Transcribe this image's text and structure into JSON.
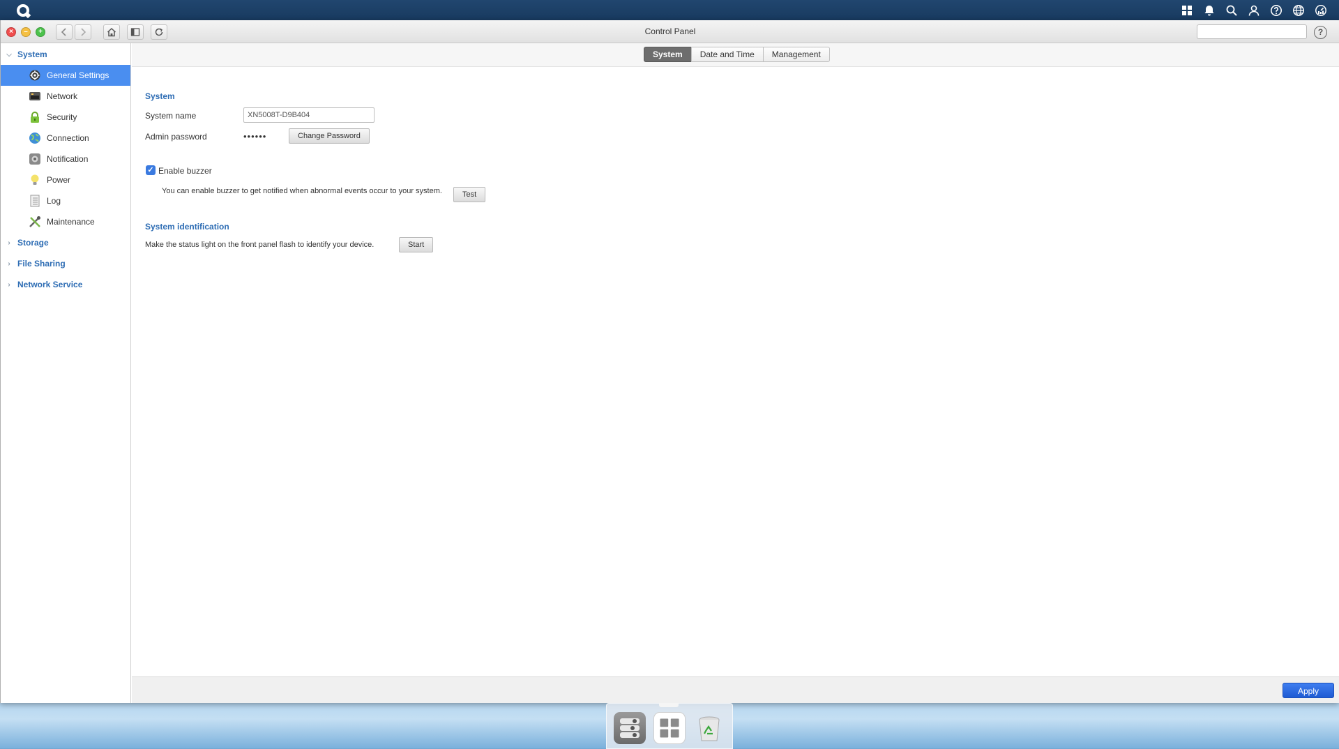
{
  "window": {
    "title": "Control Panel"
  },
  "toolbar": {
    "close_glyph": "×",
    "min_glyph": "–",
    "max_glyph": "+",
    "help_glyph": "?",
    "search_placeholder": ""
  },
  "sidebar": {
    "groups": [
      {
        "label": "System",
        "expanded": true,
        "items": [
          {
            "label": "General Settings",
            "icon": "gear-icon",
            "active": true
          },
          {
            "label": "Network",
            "icon": "network-icon"
          },
          {
            "label": "Security",
            "icon": "lock-icon"
          },
          {
            "label": "Connection",
            "icon": "globe-icon"
          },
          {
            "label": "Notification",
            "icon": "notification-icon"
          },
          {
            "label": "Power",
            "icon": "bulb-icon"
          },
          {
            "label": "Log",
            "icon": "log-icon"
          },
          {
            "label": "Maintenance",
            "icon": "tools-icon"
          }
        ]
      },
      {
        "label": "Storage",
        "expanded": false
      },
      {
        "label": "File Sharing",
        "expanded": false
      },
      {
        "label": "Network Service",
        "expanded": false
      }
    ],
    "chevron_open": "⌵",
    "chevron_closed": "›"
  },
  "tabs": [
    {
      "label": "System",
      "active": true
    },
    {
      "label": "Date and Time"
    },
    {
      "label": "Management"
    }
  ],
  "system": {
    "section_title": "System",
    "system_name_label": "System name",
    "system_name_value": "XN5008T-D9B404",
    "admin_password_label": "Admin password",
    "admin_password_mask": "••••••",
    "change_password_label": "Change Password",
    "enable_buzzer_label": "Enable buzzer",
    "enable_buzzer_checked": true,
    "check_glyph": "✓",
    "buzzer_description": "You can enable buzzer to get notified when abnormal events occur to your system.",
    "test_label": "Test"
  },
  "identification": {
    "section_title": "System identification",
    "description": "Make the status light on the front panel flash to identify your device.",
    "start_label": "Start"
  },
  "footer": {
    "apply_label": "Apply"
  },
  "colors": {
    "accent": "#4a8ef0",
    "link": "#2e6db4",
    "apply": "#1e5bd3"
  }
}
